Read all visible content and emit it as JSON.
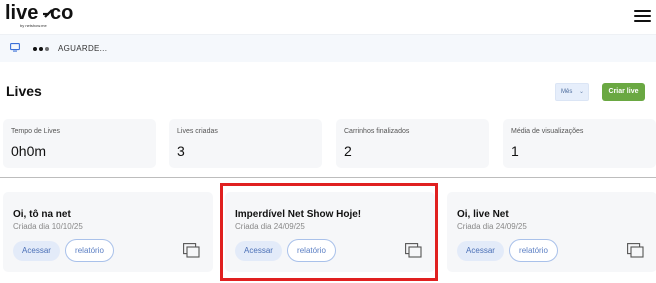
{
  "brand": {
    "name": "live co",
    "sub": "by netshow.me"
  },
  "status": {
    "text": "AGUARDE..."
  },
  "page": {
    "title": "Lives"
  },
  "controls": {
    "period": "Mês",
    "create_label": "Criar live"
  },
  "stats": [
    {
      "label": "Tempo de Lives",
      "value": "0h0m"
    },
    {
      "label": "Lives criadas",
      "value": "3"
    },
    {
      "label": "Carrinhos finalizados",
      "value": "2"
    },
    {
      "label": "Média de visualizações",
      "value": "1"
    }
  ],
  "lives": [
    {
      "title": "Oi, tô na net",
      "date": "Criada dia 10/10/25",
      "primary": "Acessar",
      "secondary": "relatório"
    },
    {
      "title": "Imperdível Net Show Hoje!",
      "date": "Criada dia 24/09/25",
      "primary": "Acessar",
      "secondary": "relatório"
    },
    {
      "title": "Oi, live Net",
      "date": "Criada dia 24/09/25",
      "primary": "Acessar",
      "secondary": "relatório"
    }
  ],
  "colors": {
    "accent": "#6aa842",
    "highlight": "#e02020",
    "link": "#4a6fb6"
  },
  "icons": [
    "menu-icon",
    "monitor-icon",
    "loading-dots-icon",
    "copy-icon"
  ]
}
